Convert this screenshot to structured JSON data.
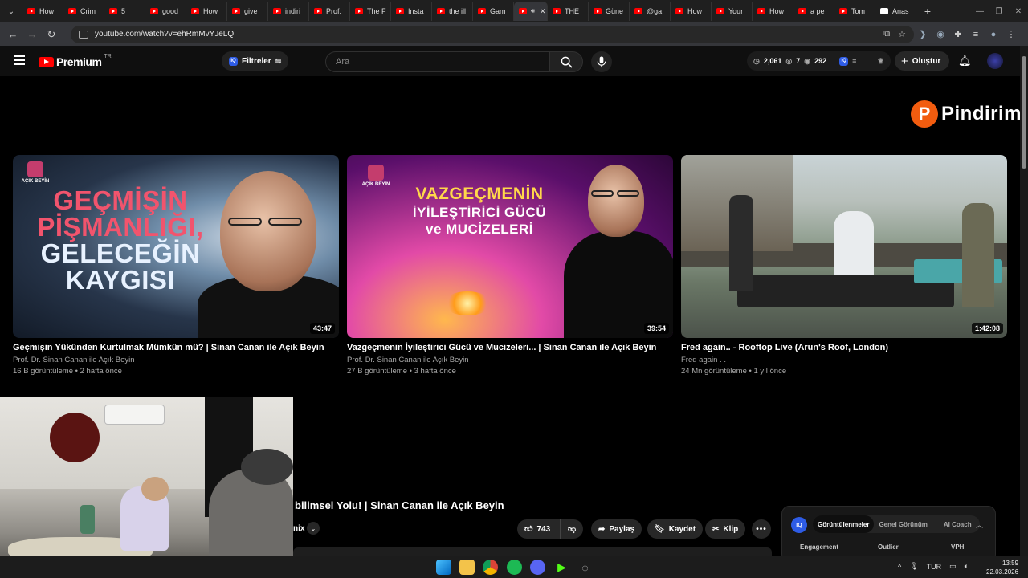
{
  "browser": {
    "tabs": [
      {
        "label": "How",
        "icon": "youtube-icon"
      },
      {
        "label": "Crim",
        "icon": "youtube-icon"
      },
      {
        "label": "5",
        "icon": "youtube-icon"
      },
      {
        "label": "good",
        "icon": "youtube-icon"
      },
      {
        "label": "How",
        "icon": "youtube-icon"
      },
      {
        "label": "give",
        "icon": "youtube-icon"
      },
      {
        "label": "indiri",
        "icon": "youtube-icon"
      },
      {
        "label": "Prof.",
        "icon": "youtube-icon"
      },
      {
        "label": "The F",
        "icon": "youtube-icon"
      },
      {
        "label": "Insta",
        "icon": "youtube-icon"
      },
      {
        "label": "the ill",
        "icon": "youtube-icon"
      },
      {
        "label": "Gam",
        "icon": "youtube-icon"
      },
      {
        "label": "",
        "icon": "youtube-icon",
        "active": true
      },
      {
        "label": "THE",
        "icon": "youtube-icon"
      },
      {
        "label": "Güne",
        "icon": "youtube-icon"
      },
      {
        "label": "@ga",
        "icon": "youtube-icon"
      },
      {
        "label": "How",
        "icon": "youtube-icon"
      },
      {
        "label": "Your",
        "icon": "youtube-icon"
      },
      {
        "label": "How",
        "icon": "youtube-icon"
      },
      {
        "label": "a pe",
        "icon": "youtube-icon"
      },
      {
        "label": "Tom",
        "icon": "youtube-icon"
      },
      {
        "label": "Anas",
        "icon": "x-icon"
      }
    ],
    "url": "youtube.com/watch?v=ehRmMvYJeLQ"
  },
  "yt": {
    "brand": "Premium",
    "country": "TR",
    "filters_label": "Filtreler",
    "search_placeholder": "Ara",
    "stats": {
      "views": "2,061",
      "watching": "7",
      "third": "292"
    },
    "create_label": "Oluştur"
  },
  "watermark": {
    "letter": "P",
    "text": "Pindirim"
  },
  "videos": [
    {
      "title": "Geçmişin Yükünden Kurtulmak Mümkün mü? | Sinan Canan ile Açık Beyin",
      "channel": "Prof. Dr. Sinan Canan ile Açık Beyin",
      "meta": "16 B görüntüleme • 2 hafta önce",
      "duration": "43:47",
      "thumb_lines": [
        "GEÇMİŞİN",
        "PİŞMANLIĞI,",
        "GELECEĞİN",
        "KAYGISI"
      ],
      "logo_text": "AÇIK BEYİN"
    },
    {
      "title": "Vazgeçmenin İyileştirici Gücü ve Mucizeleri... | Sinan Canan ile Açık Beyin",
      "channel": "Prof. Dr. Sinan Canan ile Açık Beyin",
      "meta": "27 B görüntüleme • 3 hafta önce",
      "duration": "39:54",
      "thumb_lines": [
        "VAZGEÇMENİN",
        "İYİLEŞTİRİCİ GÜCÜ",
        "ve MUCİZELERİ"
      ],
      "logo_text": "AÇIK BEYİN"
    },
    {
      "title": "Fred again.. - Rooftop Live (Arun's Roof, London)",
      "channel": "Fred again . .",
      "meta": "24 Mn görüntüleme • 1 yıl önce",
      "duration": "1:42:08"
    }
  ],
  "current_video": {
    "title_fragment": "bilimsel Yolu! | Sinan Canan ile Açık Beyin",
    "remix_fragment": "nix",
    "likes": "743",
    "share_label": "Paylaş",
    "save_label": "Kaydet",
    "clip_label": "Klip"
  },
  "iq_panel": {
    "logo": "IQ",
    "tabs": [
      "Görüntülenmeler",
      "Genel Görünüm",
      "AI Coach"
    ],
    "active_tab": "Görüntülenmeler",
    "columns": [
      "Engagement",
      "Outlier",
      "VPH"
    ]
  },
  "taskbar": {
    "language": "TUR",
    "time": "13:59",
    "date": "22.03.2026"
  },
  "colors": {
    "yt_red": "#ff0000",
    "iq_blue": "#2e5ce6",
    "watermark_orange": "#f25c0f"
  }
}
